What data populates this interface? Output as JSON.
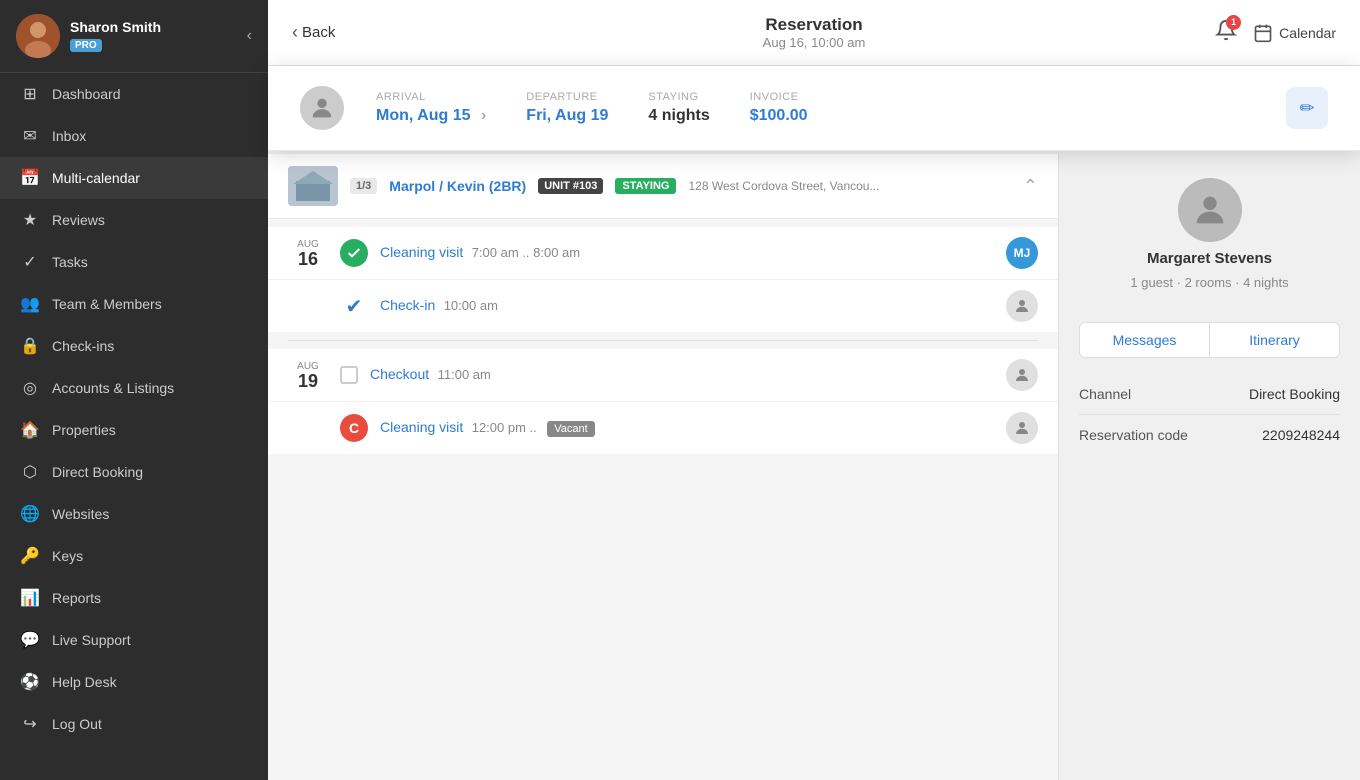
{
  "sidebar": {
    "user": {
      "name": "Sharon Smith",
      "badge": "PRO"
    },
    "nav": [
      {
        "id": "dashboard",
        "label": "Dashboard",
        "icon": "⊞"
      },
      {
        "id": "inbox",
        "label": "Inbox",
        "icon": "✉"
      },
      {
        "id": "multi-calendar",
        "label": "Multi-calendar",
        "icon": "📅",
        "active": true
      },
      {
        "id": "reviews",
        "label": "Reviews",
        "icon": "★"
      },
      {
        "id": "tasks",
        "label": "Tasks",
        "icon": "✓"
      },
      {
        "id": "team",
        "label": "Team & Members",
        "icon": "👥"
      },
      {
        "id": "checkins",
        "label": "Check-ins",
        "icon": "🔓"
      },
      {
        "id": "accounts",
        "label": "Accounts & Listings",
        "icon": "●"
      },
      {
        "id": "properties",
        "label": "Properties",
        "icon": "🏠"
      },
      {
        "id": "direct-booking",
        "label": "Direct Booking",
        "icon": "🌐"
      },
      {
        "id": "websites",
        "label": "Websites",
        "icon": "🌐"
      },
      {
        "id": "keys",
        "label": "Keys",
        "icon": "🔑"
      },
      {
        "id": "reports",
        "label": "Reports",
        "icon": "📊"
      },
      {
        "id": "live-support",
        "label": "Live Support",
        "icon": "💬"
      },
      {
        "id": "help-desk",
        "label": "Help Desk",
        "icon": "⚽"
      },
      {
        "id": "log-out",
        "label": "Log Out",
        "icon": "⬚"
      }
    ]
  },
  "topbar": {
    "back_label": "Back",
    "title": "Reservation",
    "subtitle": "Aug 16, 10:00 am",
    "calendar_label": "Calendar",
    "notif_count": "1"
  },
  "booking_card": {
    "arrival_label": "ARRIVAL",
    "arrival_value": "Mon, Aug 15",
    "departure_label": "DEPARTURE",
    "departure_value": "Fri, Aug 19",
    "staying_label": "STAYING",
    "staying_value": "4 nights",
    "invoice_label": "INVOICE",
    "invoice_value": "$100.00"
  },
  "property": {
    "badge": "1/3",
    "name": "Marpol / Kevin (2BR)",
    "unit": "UNIT #103",
    "status": "STAYING",
    "address": "128 West Cordova Street, Vancou..."
  },
  "events": [
    {
      "day_month": "AUG",
      "day_num": "16",
      "items": [
        {
          "type": "green-check",
          "name": "Cleaning visit",
          "time": "7:00 am .. 8:00 am",
          "assignee": "MJ",
          "assignee_type": "initials"
        },
        {
          "type": "blue-check",
          "name": "Check-in",
          "time": "10:00 am",
          "assignee": "",
          "assignee_type": "person"
        }
      ]
    },
    {
      "day_month": "AUG",
      "day_num": "19",
      "items": [
        {
          "type": "empty-checkbox",
          "name": "Checkout",
          "time": "11:00 am",
          "assignee": "",
          "assignee_type": "person"
        },
        {
          "type": "red-c",
          "name": "Cleaning visit",
          "time": "12:00 pm ..",
          "vacant": "Vacant",
          "assignee": "",
          "assignee_type": "person"
        }
      ]
    }
  ],
  "right_panel": {
    "guest_name": "Margaret Stevens",
    "guest_meta": "1 guest · 2 rooms · 4 nights",
    "tab_messages": "Messages",
    "tab_itinerary": "Itinerary",
    "info": [
      {
        "key": "Channel",
        "value": "Direct Booking"
      },
      {
        "key": "Reservation code",
        "value": "2209248244"
      }
    ]
  }
}
